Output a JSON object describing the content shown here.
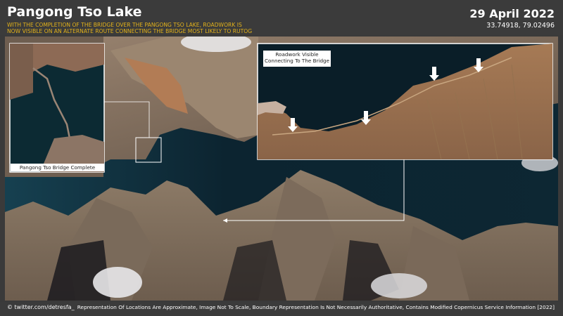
{
  "header": {
    "title": "Pangong Tso Lake",
    "subtitle_line1": "WITH THE COMPLETION OF THE BRIDGE OVER THE PANGONG TSO LAKE, ROADWORK IS",
    "subtitle_line2": "NOW VISIBLE ON AN ALTERNATE ROUTE CONNECTING THE BRIDGE MOST LIKELY TO RUTOG",
    "date": "29 April 2022",
    "coordinates": "33.74918, 79.02496"
  },
  "insets": {
    "bridge_label": "Pangong Tso Bridge Complete",
    "roadwork_label_line1": "Roadwork Visible",
    "roadwork_label_line2": "Connecting To The Bridge"
  },
  "footer": {
    "handle": "© twitter.com/detresfa_",
    "disclaimer": "Representation Of Locations Are Approximate, Image Not To Scale, Boundary Representation Is Not Necessarily Authoritative, Contains Modified Copernicus Service Information [2022]"
  },
  "colors": {
    "accent": "#e3b21a",
    "background": "#3b3b3b",
    "water": "#0e2630",
    "terrain": "#8a7a66"
  },
  "arrows": [
    {
      "icon": "down-arrow-icon"
    },
    {
      "icon": "down-arrow-icon"
    },
    {
      "icon": "down-arrow-icon"
    },
    {
      "icon": "down-arrow-icon"
    }
  ]
}
